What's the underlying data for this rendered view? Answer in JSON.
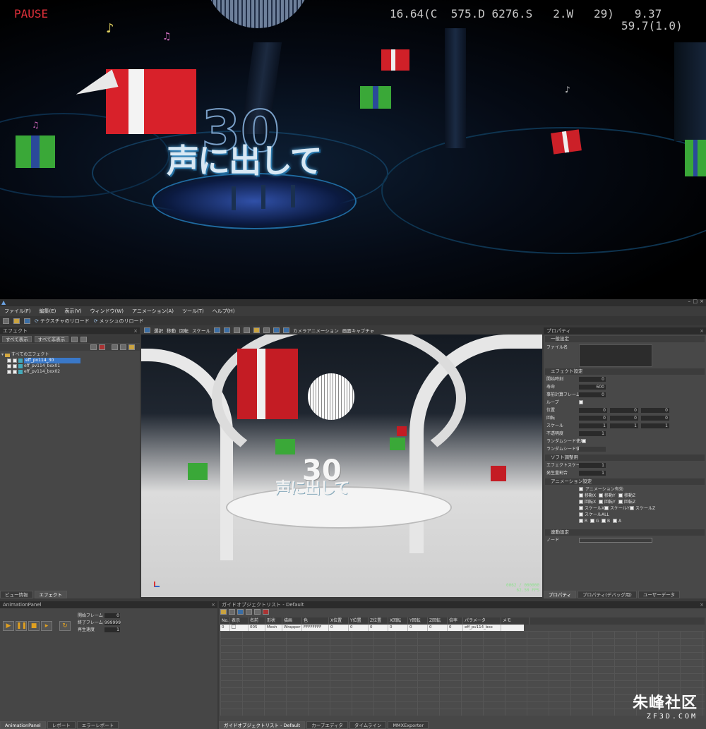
{
  "game": {
    "pause": "PAUSE",
    "stats_line1": "16.64(C  575.D 6276.S   2.W   29)   9.37",
    "stats_line2": "59.7(1.0)",
    "stage_text": "声に出して",
    "logo_number": "30"
  },
  "menu": {
    "items": [
      "ファイル(F)",
      "編集(E)",
      "表示(V)",
      "ウィンドウ(W)",
      "アニメーション(A)",
      "ツール(T)",
      "ヘルプ(H)"
    ],
    "reload_texture": "テクスチャのリロード",
    "reload_mesh": "メッシュのリロード"
  },
  "effect_panel": {
    "title": "エフェクト",
    "show_all": "すべて表示",
    "hide_all": "すべて非表示",
    "tree": [
      {
        "label": "すべてのエフェクト"
      },
      {
        "label": "eff_pv114_30"
      },
      {
        "label": "eff_pv114_box01"
      },
      {
        "label": "eff_pv114_box02"
      }
    ],
    "tabs": [
      "ビュー情報",
      "エフェクト"
    ]
  },
  "viewport_toolbar": {
    "select": "選択",
    "move": "移動",
    "rotate": "回転",
    "scale": "スケール",
    "camera_anim": "カメラアニメーション",
    "screen_capture": "画面キャプチャ"
  },
  "viewport": {
    "stage_text": "声に出して",
    "logo_number": "30",
    "fps_line1": "0062 / 000000",
    "fps_line2": "62.50 FPS"
  },
  "properties": {
    "title": "プロパティ",
    "general": "一般設定",
    "file_name": "ファイル名",
    "effect_settings": "エフェクト設定",
    "start_time": {
      "label": "開始時刻",
      "value": "0"
    },
    "lifetime": {
      "label": "寿命",
      "value": "600"
    },
    "precalc": {
      "label": "事前計算フレーム",
      "value": "0"
    },
    "loop": "ループ",
    "position": {
      "label": "位置",
      "values": [
        "0",
        "0",
        "0"
      ]
    },
    "rotation": {
      "label": "回転",
      "values": [
        "0",
        "0",
        "0"
      ]
    },
    "scale": {
      "label": "スケール",
      "values": [
        "1",
        "1",
        "1"
      ]
    },
    "opacity": {
      "label": "不透明度",
      "value": "1"
    },
    "random_seed_use": "ランダムシード使用",
    "random_seed": "ランダムシード値",
    "soft_adjust": "ソフト調整用",
    "effect_scale": {
      "label": "エフェクトスケール",
      "value": "1"
    },
    "emission_ratio": {
      "label": "発生量割合",
      "value": "1"
    },
    "anim_settings": "アニメーション設定",
    "anim_enabled": "アニメーション有効",
    "anim_checks": [
      "移動X",
      "移動Y",
      "移動Z",
      "回転X",
      "回転Y",
      "回転Z",
      "スケールX",
      "スケールY",
      "スケールZ",
      "スケールALL"
    ],
    "rgba": [
      "R",
      "G",
      "B",
      "A"
    ],
    "link_settings": "連動設定",
    "node": "ノード",
    "tabs": [
      "プロパティ",
      "プロパティ(デバッグ用)",
      "ユーザーデータ"
    ]
  },
  "anim_panel": {
    "title": "AnimationPanel",
    "start_frame": {
      "label": "開始フレーム",
      "value": "0"
    },
    "end_frame": {
      "label": "終了フレーム",
      "value": "999999"
    },
    "speed": {
      "label": "再生速度",
      "value": "1"
    },
    "tabs": [
      "AnimationPanel",
      "レポート",
      "エラーレポート"
    ]
  },
  "guide_panel": {
    "title": "ガイドオブジェクトリスト - Default",
    "columns": [
      "No.",
      "表示",
      "名前",
      "形状",
      "描画",
      "色",
      "X位置",
      "Y位置",
      "Z位置",
      "X回転",
      "Y回転",
      "Z回転",
      "倍率",
      "パラメータ",
      "メモ"
    ],
    "row": [
      "0",
      "",
      "005",
      "Mesh",
      "Wrapper",
      "FFFFFFFF",
      "0",
      "0",
      "0",
      "0",
      "0",
      "0",
      "0",
      "eff_pv114_box",
      ""
    ],
    "tabs": [
      "ガイドオブジェクトリスト - Default",
      "カーブエディタ",
      "タイムライン",
      "MMXExporter"
    ]
  },
  "watermark": {
    "main": "朱峰社区",
    "sub": "ZF3D.COM"
  },
  "colors": {
    "pause_red": "#e0303a",
    "gift_red": "#d8212a",
    "gift_green": "#38a838",
    "selection_blue": "#3a78c8",
    "fps_green": "#8fe08f"
  }
}
